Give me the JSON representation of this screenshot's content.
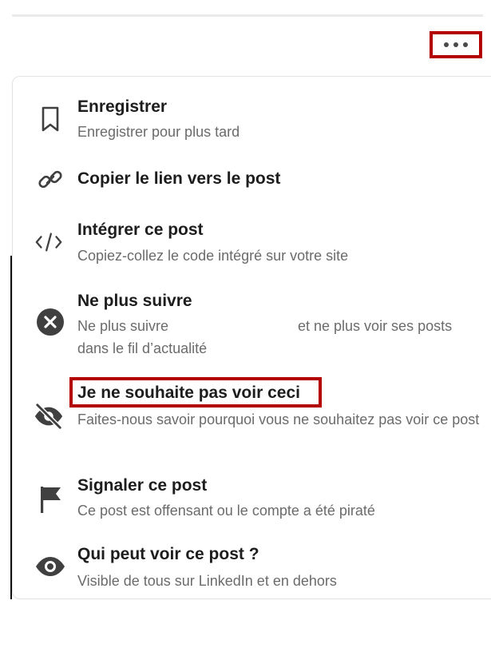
{
  "post": {
    "more_button": "More actions"
  },
  "menu": {
    "items": [
      {
        "id": "save",
        "title": "Enregistrer",
        "subtitle": "Enregistrer pour plus tard",
        "icon": "bookmark-icon"
      },
      {
        "id": "copy-link",
        "title": "Copier le lien vers le post",
        "subtitle": "",
        "icon": "link-icon"
      },
      {
        "id": "embed",
        "title": "Intégrer ce post",
        "subtitle": "Copiez-collez le code intégré sur votre site",
        "icon": "code-icon"
      },
      {
        "id": "unfollow",
        "title": "Ne plus suivre",
        "subtitle_a": "Ne plus suivre",
        "subtitle_b": "et ne plus voir ses posts",
        "subtitle_c": "dans le fil d’actualité",
        "icon": "close-circle-icon"
      },
      {
        "id": "hide",
        "title": "Je ne souhaite pas voir ceci",
        "subtitle": "Faites-nous savoir pourquoi vous ne souhaitez pas voir ce post",
        "icon": "eye-off-icon"
      },
      {
        "id": "report",
        "title": "Signaler ce post",
        "subtitle": "Ce post est offensant ou le compte a été piraté",
        "icon": "flag-icon"
      },
      {
        "id": "visibility",
        "title": "Qui peut voir ce post ?",
        "subtitle": "Visible de tous sur LinkedIn et en dehors",
        "icon": "eye-icon"
      }
    ]
  },
  "colors": {
    "highlight": "#b30000",
    "title": "#1d1d1d",
    "subtitle": "#6b6b6b",
    "icon": "#404040"
  }
}
